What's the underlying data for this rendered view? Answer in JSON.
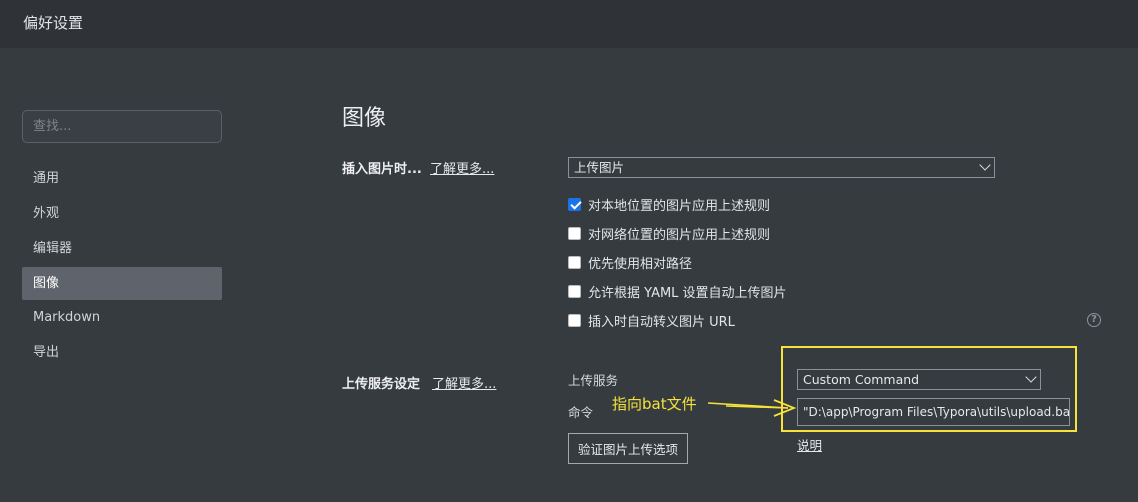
{
  "window": {
    "title": "偏好设置"
  },
  "sidebar": {
    "search_placeholder": "查找...",
    "items": [
      {
        "label": "通用"
      },
      {
        "label": "外观"
      },
      {
        "label": "编辑器"
      },
      {
        "label": "图像",
        "active": true
      },
      {
        "label": "Markdown"
      },
      {
        "label": "导出"
      }
    ]
  },
  "main": {
    "section_title": "图像",
    "insert_image": {
      "label": "插入图片时...",
      "learn_more": "了解更多...",
      "select_value": "上传图片",
      "options": [
        {
          "label": "对本地位置的图片应用上述规则",
          "checked": true
        },
        {
          "label": "对网络位置的图片应用上述规则",
          "checked": false
        },
        {
          "label": "优先使用相对路径",
          "checked": false
        },
        {
          "label": "允许根据 YAML 设置自动上传图片",
          "checked": false
        },
        {
          "label": "插入时自动转义图片 URL",
          "checked": false
        }
      ],
      "help_icon": "question-circle-icon",
      "help_glyph": "?"
    },
    "upload_service": {
      "label": "上传服务设定",
      "learn_more": "了解更多...",
      "service_label": "上传服务",
      "service_value": "Custom Command",
      "command_label": "命令",
      "command_value": "\"D:\\app\\Program Files\\Typora\\utils\\upload.bat\"",
      "explain_link": "说明",
      "verify_button": "验证图片上传选项"
    }
  },
  "annotation": {
    "text": "指向bat文件",
    "color": "#f6e23a"
  },
  "colors": {
    "background": "#363b40",
    "titlebar": "#2f3338",
    "active_nav": "#5f636b",
    "checkbox_checked": "#1a73e8"
  }
}
